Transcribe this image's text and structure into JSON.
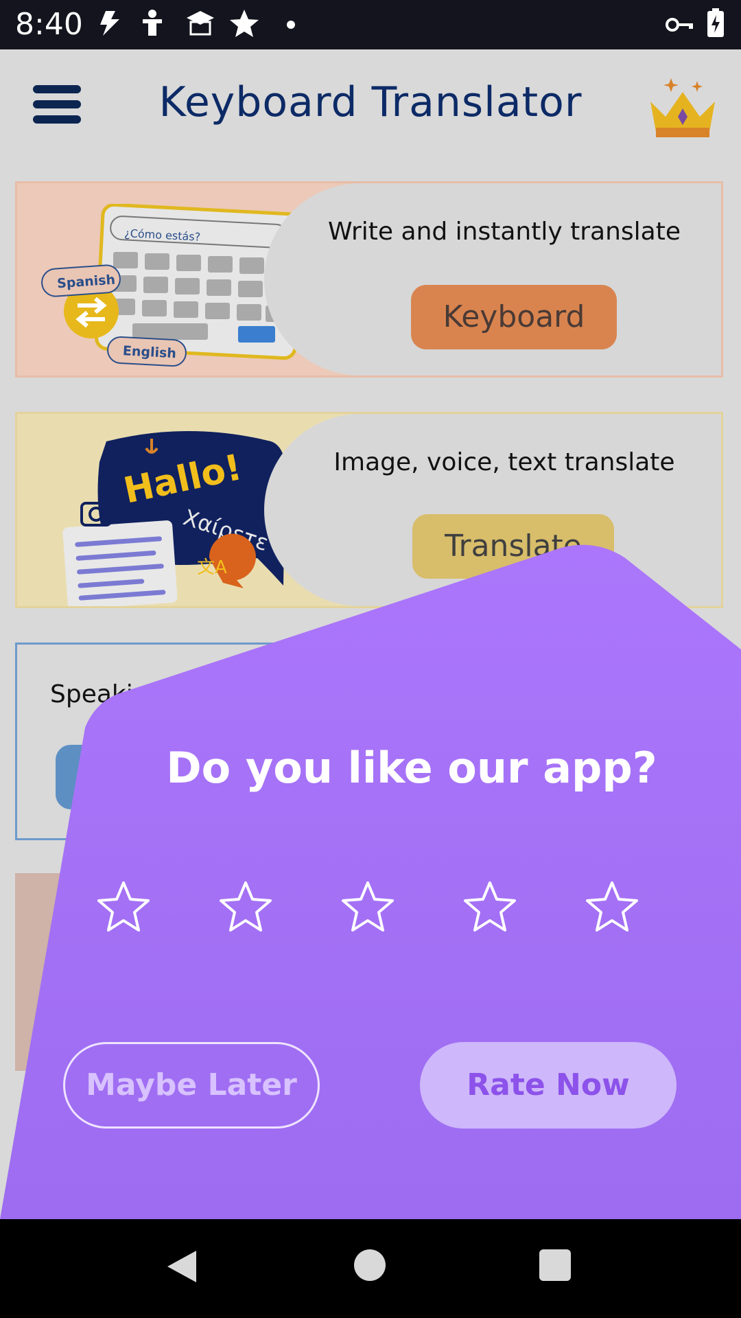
{
  "status_bar": {
    "time": "8:40",
    "icons": [
      "flash-icon",
      "fitness-icon",
      "school-icon",
      "star-icon",
      "dot-icon",
      "vpn-key-icon",
      "battery-charging-icon"
    ]
  },
  "app": {
    "title": "Keyboard Translator",
    "menu_icon": "hamburger-menu-icon",
    "premium_icon": "crown-icon"
  },
  "cards": {
    "keyboard": {
      "description": "Write and instantly translate",
      "button": "Keyboard",
      "illustration_text": [
        "¿Cómo estás?",
        "Spanish",
        "English"
      ]
    },
    "translate": {
      "description": "Image, voice, text translate",
      "button": "Translate",
      "illustration_text": [
        "Hallo!",
        "Χαίρετε"
      ]
    },
    "speaking": {
      "description": "Speaking t"
    }
  },
  "dialog": {
    "title": "Do you like our app?",
    "stars_total": 5,
    "stars_selected": 0,
    "maybe_later": "Maybe Later",
    "rate_now": "Rate Now",
    "color": "#a46ff6"
  },
  "nav": {
    "back": "back-icon",
    "home": "home-icon",
    "recents": "recents-icon"
  }
}
